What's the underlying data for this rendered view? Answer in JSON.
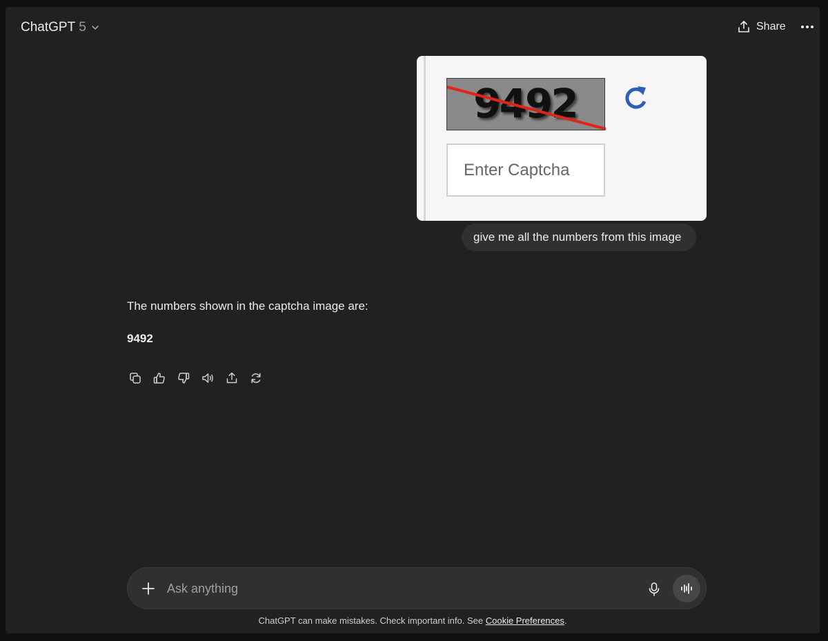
{
  "header": {
    "model_name": "ChatGPT",
    "model_version": "5",
    "share_label": "Share"
  },
  "conversation": {
    "attachment": {
      "captcha_text": "9492",
      "input_placeholder": "Enter Captcha",
      "refresh_icon": "refresh-icon",
      "colors": {
        "refresh": "#2b5fb8",
        "strike": "#e2231a",
        "captcha_bg": "#8a8a8a"
      }
    },
    "user_message": "give me all the numbers from this image",
    "assistant": {
      "intro": "The numbers shown in the captcha image are:",
      "answer": "9492",
      "actions": [
        {
          "name": "copy",
          "icon": "copy-icon"
        },
        {
          "name": "thumbs-up",
          "icon": "thumbs-up-icon"
        },
        {
          "name": "thumbs-down",
          "icon": "thumbs-down-icon"
        },
        {
          "name": "read-aloud",
          "icon": "speaker-icon"
        },
        {
          "name": "share",
          "icon": "share-icon"
        },
        {
          "name": "regenerate",
          "icon": "regenerate-icon"
        }
      ]
    }
  },
  "composer": {
    "placeholder": "Ask anything",
    "value": ""
  },
  "footer": {
    "disclaimer_prefix": "ChatGPT can make mistakes. Check important info. See ",
    "cookie_link": "Cookie Preferences",
    "disclaimer_suffix": "."
  },
  "theme": {
    "background": "#212121",
    "bubble": "#303030",
    "text": "#ececec"
  }
}
